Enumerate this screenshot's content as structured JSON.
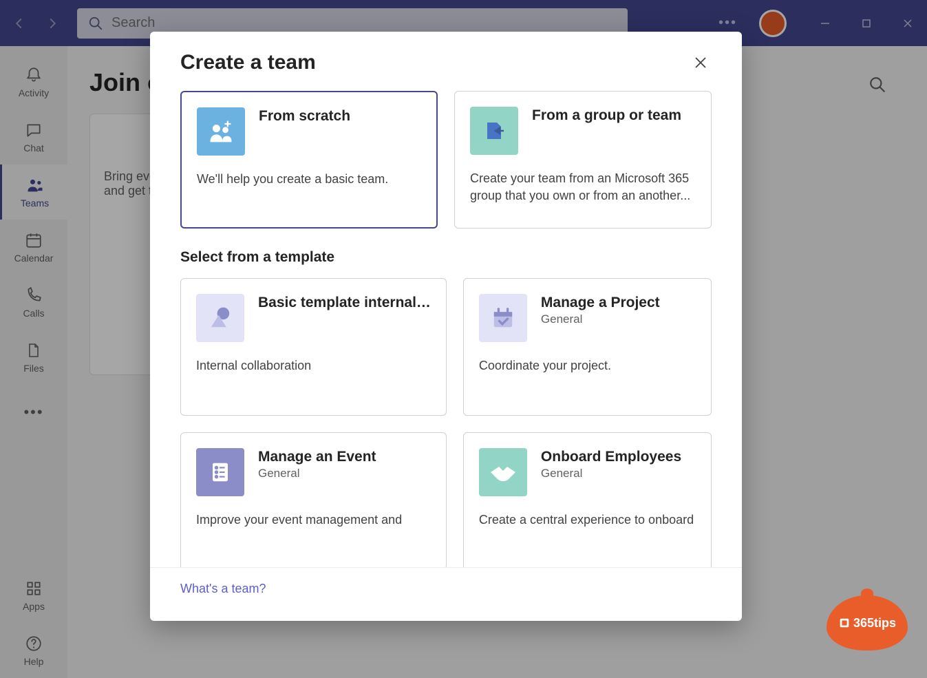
{
  "titlebar": {
    "search_placeholder": "Search"
  },
  "rail": {
    "items": [
      {
        "label": "Activity"
      },
      {
        "label": "Chat"
      },
      {
        "label": "Teams"
      },
      {
        "label": "Calendar"
      },
      {
        "label": "Calls"
      },
      {
        "label": "Files"
      }
    ],
    "apps": "Apps",
    "help": "Help"
  },
  "main": {
    "heading": "Join or create a team",
    "card_text": "Bring everyone together and get to work!"
  },
  "modal": {
    "title": "Create a team",
    "options": [
      {
        "title": "From scratch",
        "desc": "We'll help you create a basic team."
      },
      {
        "title": "From a group or team",
        "desc": "Create your team from an Microsoft 365 group that you own or from an another..."
      }
    ],
    "template_heading": "Select from a template",
    "templates": [
      {
        "title": "Basic template internal…",
        "sub": "",
        "desc": "Internal collaboration"
      },
      {
        "title": "Manage a Project",
        "sub": "General",
        "desc": "Coordinate your project."
      },
      {
        "title": "Manage an Event",
        "sub": "General",
        "desc": "Improve your event management and"
      },
      {
        "title": "Onboard Employees",
        "sub": "General",
        "desc": "Create a central experience to onboard"
      }
    ],
    "footer_link": "What's a team?"
  },
  "badge": {
    "text": "365tips"
  }
}
